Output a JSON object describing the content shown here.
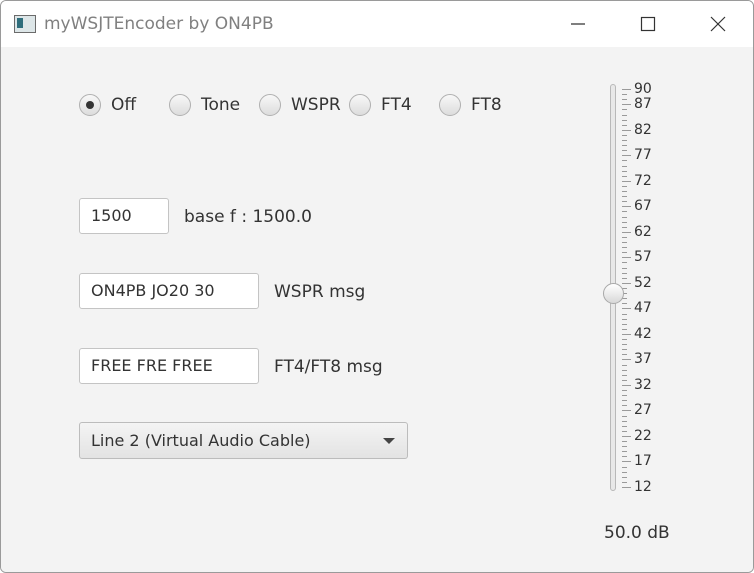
{
  "window": {
    "title": "myWSJTEncoder by ON4PB"
  },
  "mode": {
    "options": [
      {
        "label": "Off",
        "selected": true
      },
      {
        "label": "Tone",
        "selected": false
      },
      {
        "label": "WSPR",
        "selected": false
      },
      {
        "label": "FT4",
        "selected": false
      },
      {
        "label": "FT8",
        "selected": false
      }
    ]
  },
  "base_freq": {
    "value": "1500",
    "label": "base f : 1500.0"
  },
  "wspr": {
    "value": "ON4PB JO20 30",
    "label": "WSPR msg"
  },
  "ft": {
    "value": "FREE FRE FREE",
    "label": "FT4/FT8 msg"
  },
  "audio_device": {
    "selected": "Line 2 (Virtual Audio Cable)"
  },
  "level": {
    "max": 90,
    "min": 12,
    "value": 50,
    "tick_labels": [
      "90",
      "87",
      "82",
      "77",
      "72",
      "67",
      "62",
      "57",
      "52",
      "47",
      "42",
      "37",
      "32",
      "27",
      "22",
      "17",
      "12"
    ],
    "readout": "50.0 dB"
  }
}
